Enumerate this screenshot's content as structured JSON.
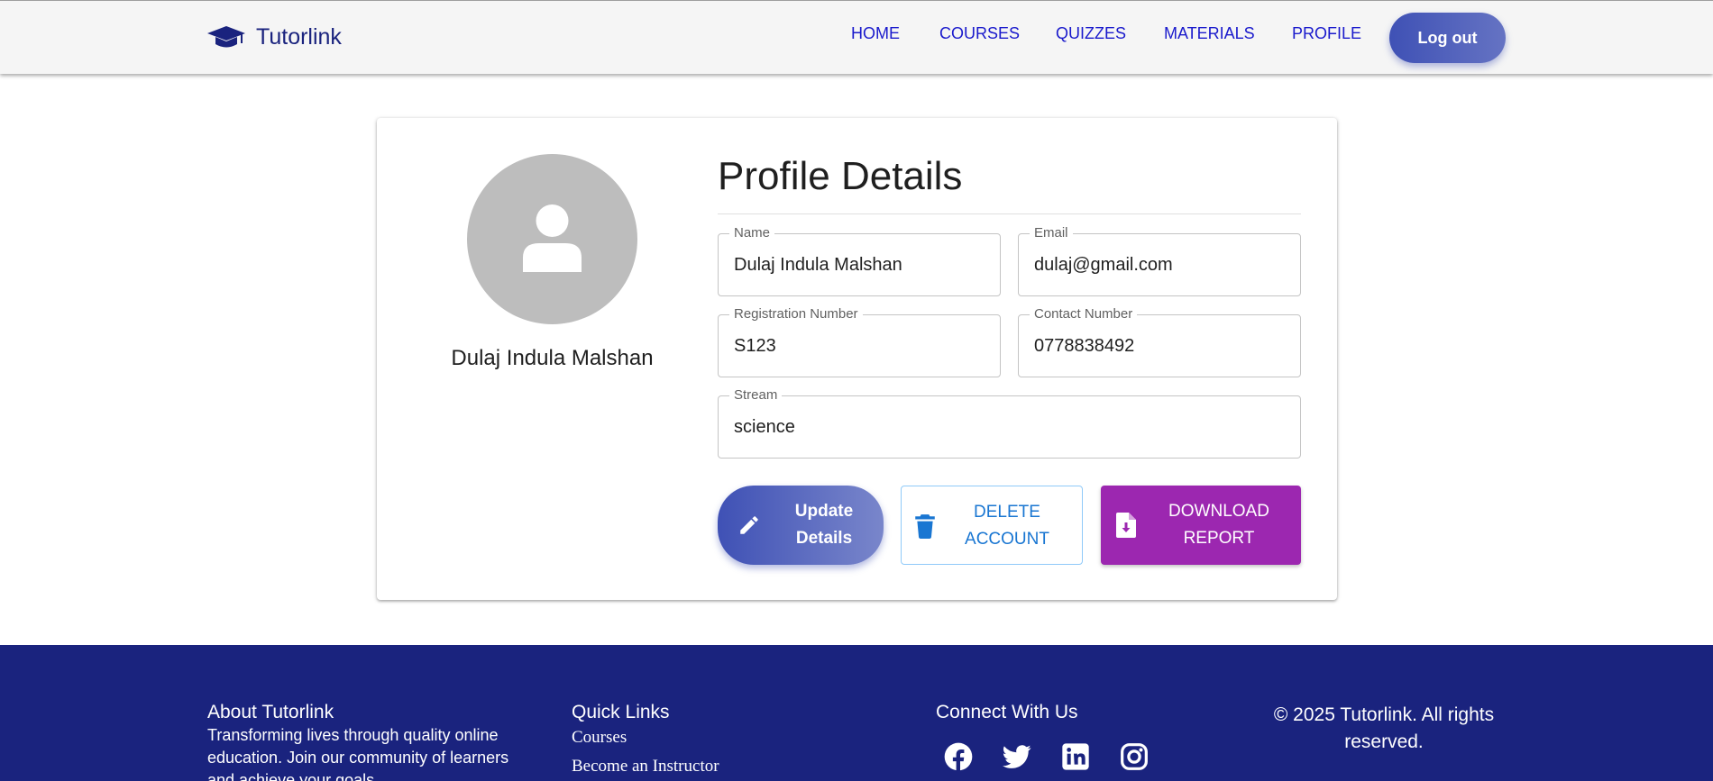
{
  "navbar": {
    "brand": "Tutorlink",
    "links": [
      "HOME",
      "COURSES",
      "QUIZZES",
      "MATERIALS",
      "PROFILE"
    ],
    "logout": "Log out"
  },
  "profile": {
    "display_name": "Dulaj Indula Malshan",
    "title": "Profile Details",
    "fields": {
      "name": {
        "label": "Name",
        "value": "Dulaj Indula Malshan"
      },
      "email": {
        "label": "Email",
        "value": "dulaj@gmail.com"
      },
      "registration": {
        "label": "Registration Number",
        "value": "S123"
      },
      "contact": {
        "label": "Contact Number",
        "value": "0778838492"
      },
      "stream": {
        "label": "Stream",
        "value": "science"
      }
    },
    "buttons": {
      "update_line1": "Update",
      "update_line2": "Details",
      "delete_line1": "DELETE",
      "delete_line2": "ACCOUNT",
      "download_line1": "DOWNLOAD",
      "download_line2": "REPORT"
    }
  },
  "footer": {
    "about_title": "About Tutorlink",
    "about_text": "Transforming lives through quality online education. Join our community of learners and achieve your goals.",
    "links_title": "Quick Links",
    "links": [
      "Courses",
      "Become an Instructor"
    ],
    "connect_title": "Connect With Us",
    "social_icons": [
      "facebook-icon",
      "twitter-icon",
      "linkedin-icon",
      "instagram-icon"
    ],
    "copyright": "© 2025 Tutorlink. All rights reserved."
  },
  "colors": {
    "primary": "#3f51b5",
    "navy": "#1a237e",
    "purple": "#9c27b0",
    "link_blue": "#1976d2"
  }
}
